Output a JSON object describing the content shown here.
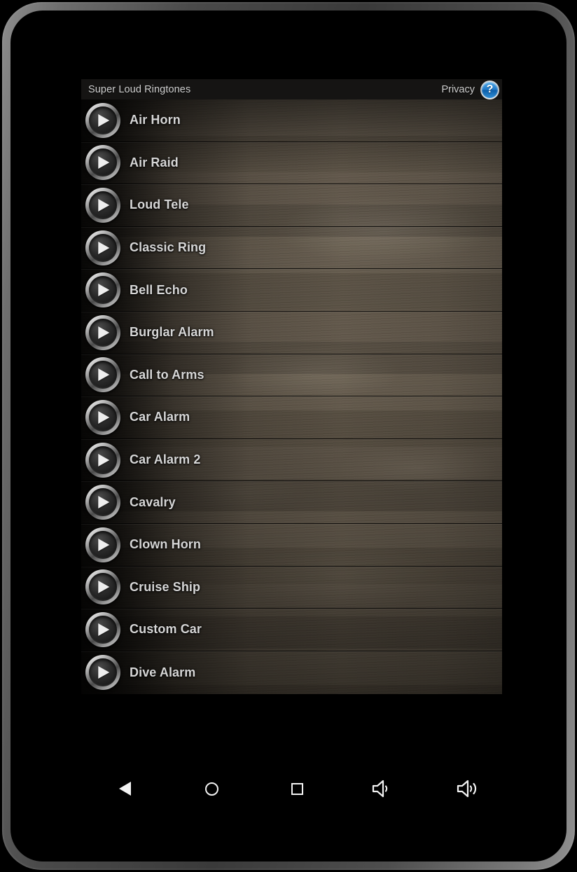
{
  "app": {
    "title": "Super Loud Ringtones",
    "privacy_label": "Privacy",
    "help_icon": "help-question-icon",
    "help_glyph": "?",
    "accent_color": "#1f79c9",
    "text_color": "#d6d6d6"
  },
  "ringtones": [
    {
      "name": "Air Horn",
      "play_icon": "play-icon"
    },
    {
      "name": "Air Raid",
      "play_icon": "play-icon"
    },
    {
      "name": "Loud Tele",
      "play_icon": "play-icon"
    },
    {
      "name": "Classic Ring",
      "play_icon": "play-icon"
    },
    {
      "name": "Bell Echo",
      "play_icon": "play-icon"
    },
    {
      "name": "Burglar Alarm",
      "play_icon": "play-icon"
    },
    {
      "name": "Call to Arms",
      "play_icon": "play-icon"
    },
    {
      "name": "Car Alarm",
      "play_icon": "play-icon"
    },
    {
      "name": "Car Alarm 2",
      "play_icon": "play-icon"
    },
    {
      "name": "Cavalry",
      "play_icon": "play-icon"
    },
    {
      "name": "Clown Horn",
      "play_icon": "play-icon"
    },
    {
      "name": "Cruise Ship",
      "play_icon": "play-icon"
    },
    {
      "name": "Custom Car",
      "play_icon": "play-icon"
    },
    {
      "name": "Dive Alarm",
      "play_icon": "play-icon"
    }
  ],
  "nav_bar": {
    "buttons": [
      {
        "icon": "back-triangle-icon",
        "label": "Back"
      },
      {
        "icon": "home-circle-icon",
        "label": "Home"
      },
      {
        "icon": "recents-square-icon",
        "label": "Recents"
      },
      {
        "icon": "volume-down-icon",
        "label": "Volume Down"
      },
      {
        "icon": "volume-up-icon",
        "label": "Volume Up"
      }
    ]
  }
}
